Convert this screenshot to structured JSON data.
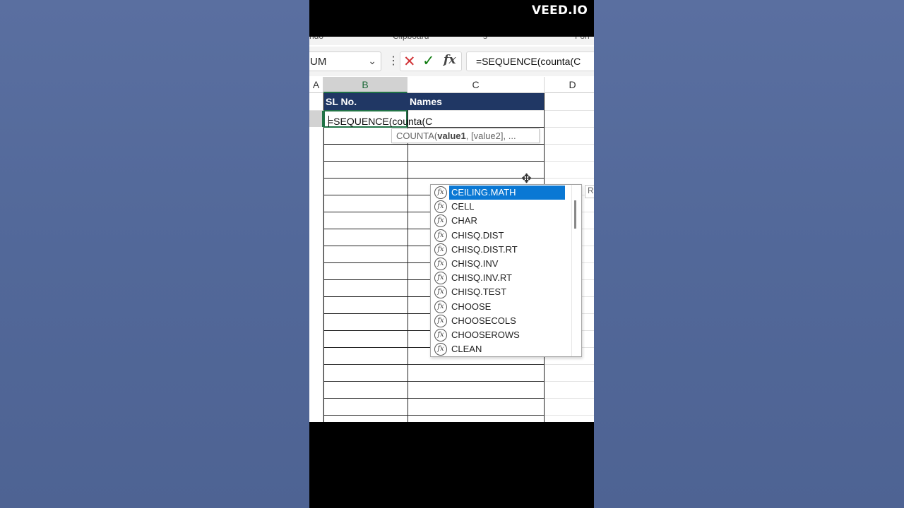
{
  "watermark": "VEED.IO",
  "formula_bar": {
    "name_box": "UM",
    "cancel_icon": "close-x-icon",
    "enter_icon": "checkmark-icon",
    "fx_label": "fx",
    "formula": "=SEQUENCE(counta(C"
  },
  "columns": [
    "A",
    "B",
    "C",
    "D"
  ],
  "table": {
    "headers": [
      "SL No.",
      "Names"
    ],
    "header_bg": "#203764"
  },
  "active_cell": {
    "value": "=SEQUENCE(counta(C"
  },
  "tooltip": {
    "fn": "COUNTA(",
    "arg1": "value1",
    "rest": ", [value2], ..."
  },
  "side_box_letter": "R",
  "autocomplete": {
    "selected_index": 0,
    "items": [
      "CEILING.MATH",
      "CELL",
      "CHAR",
      "CHISQ.DIST",
      "CHISQ.DIST.RT",
      "CHISQ.INV",
      "CHISQ.INV.RT",
      "CHISQ.TEST",
      "CHOOSE",
      "CHOOSECOLS",
      "CHOOSEROWS",
      "CLEAN"
    ]
  },
  "colors": {
    "accent_green": "#217346",
    "selection_blue": "#0a78d4"
  }
}
